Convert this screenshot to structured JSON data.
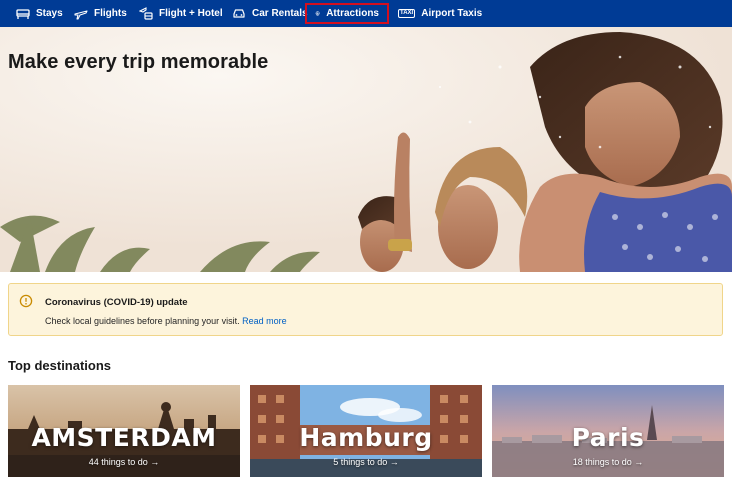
{
  "nav": {
    "items": [
      {
        "label": "Stays",
        "icon": "bed-icon"
      },
      {
        "label": "Flights",
        "icon": "airplane-icon"
      },
      {
        "label": "Flight + Hotel",
        "icon": "flight-hotel-icon"
      },
      {
        "label": "Car Rentals",
        "icon": "car-icon"
      },
      {
        "label": "Attractions",
        "icon": "attractions-icon",
        "active": true
      },
      {
        "label": "Airport Taxis",
        "icon": "taxi-icon",
        "badge": "TAXI"
      }
    ]
  },
  "hero": {
    "title": "Make every trip memorable"
  },
  "alert": {
    "icon": "info-circle-icon",
    "title": "Coronavirus (COVID-19) update",
    "body": "Check local guidelines before planning your visit.",
    "link": "Read more"
  },
  "destinations": {
    "heading": "Top destinations",
    "cards": [
      {
        "name": "AMSTERDAM",
        "count": "44 things to do →"
      },
      {
        "name": "Hamburg",
        "count": "5 things to do →"
      },
      {
        "name": "Paris",
        "count": "18 things to do →"
      }
    ]
  },
  "colors": {
    "nav_bg": "#003b95",
    "active_outline": "#d40f1f",
    "alert_bg": "#fdf4dc",
    "alert_border": "#f0d58a",
    "link": "#0060c4"
  }
}
